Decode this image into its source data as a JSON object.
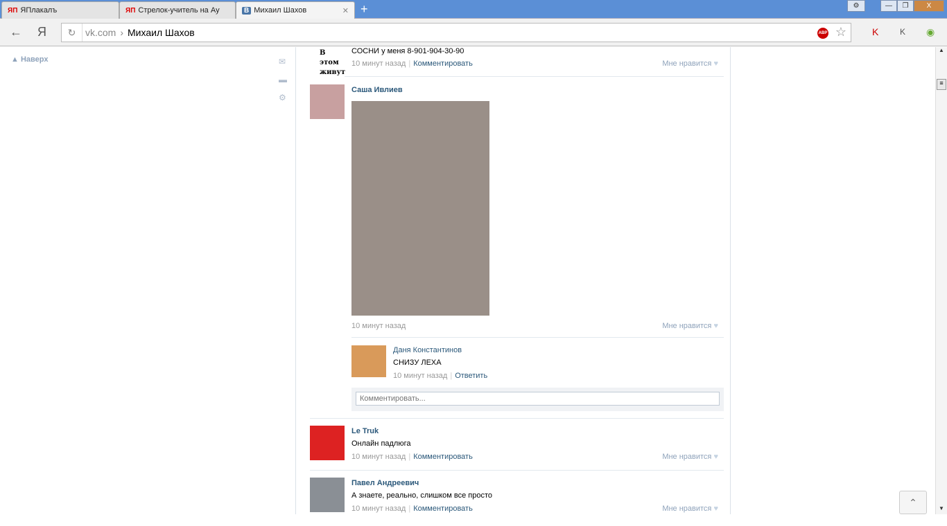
{
  "tabs": [
    {
      "label": "ЯПлакалъ",
      "fav": "ЯП"
    },
    {
      "label": "Стрелок-учитель на Ау",
      "fav": "ЯП"
    },
    {
      "label": "Михаил Шахов",
      "fav": "В"
    }
  ],
  "address": {
    "host": "vk.com",
    "sep": "›",
    "path": "Михаил Шахов"
  },
  "sidebar": {
    "up": "Наверх"
  },
  "posts": [
    {
      "avatar_text": "В этом живут",
      "text": "СОСНИ у меня 8-901-904-30-90",
      "time": "10 минут назад",
      "action": "Комментировать",
      "like": "Мне нравится"
    },
    {
      "name": "Саша Ивлиев",
      "time": "10 минут назад",
      "like": "Мне нравится",
      "comment": {
        "name": "Даня Константинов",
        "text": "СНИЗУ ЛЕХА",
        "time": "10 минут назад",
        "action": "Ответить"
      },
      "comment_placeholder": "Комментировать..."
    },
    {
      "name": "Le Truk",
      "text": "Онлайн падлюга",
      "time": "10 минут назад",
      "action": "Комментировать",
      "like": "Мне нравится"
    },
    {
      "name": "Павел Андреевич",
      "text": "А знаете, реально, слишком все просто",
      "time": "10 минут назад",
      "action": "Комментировать",
      "like": "Мне нравится"
    }
  ]
}
